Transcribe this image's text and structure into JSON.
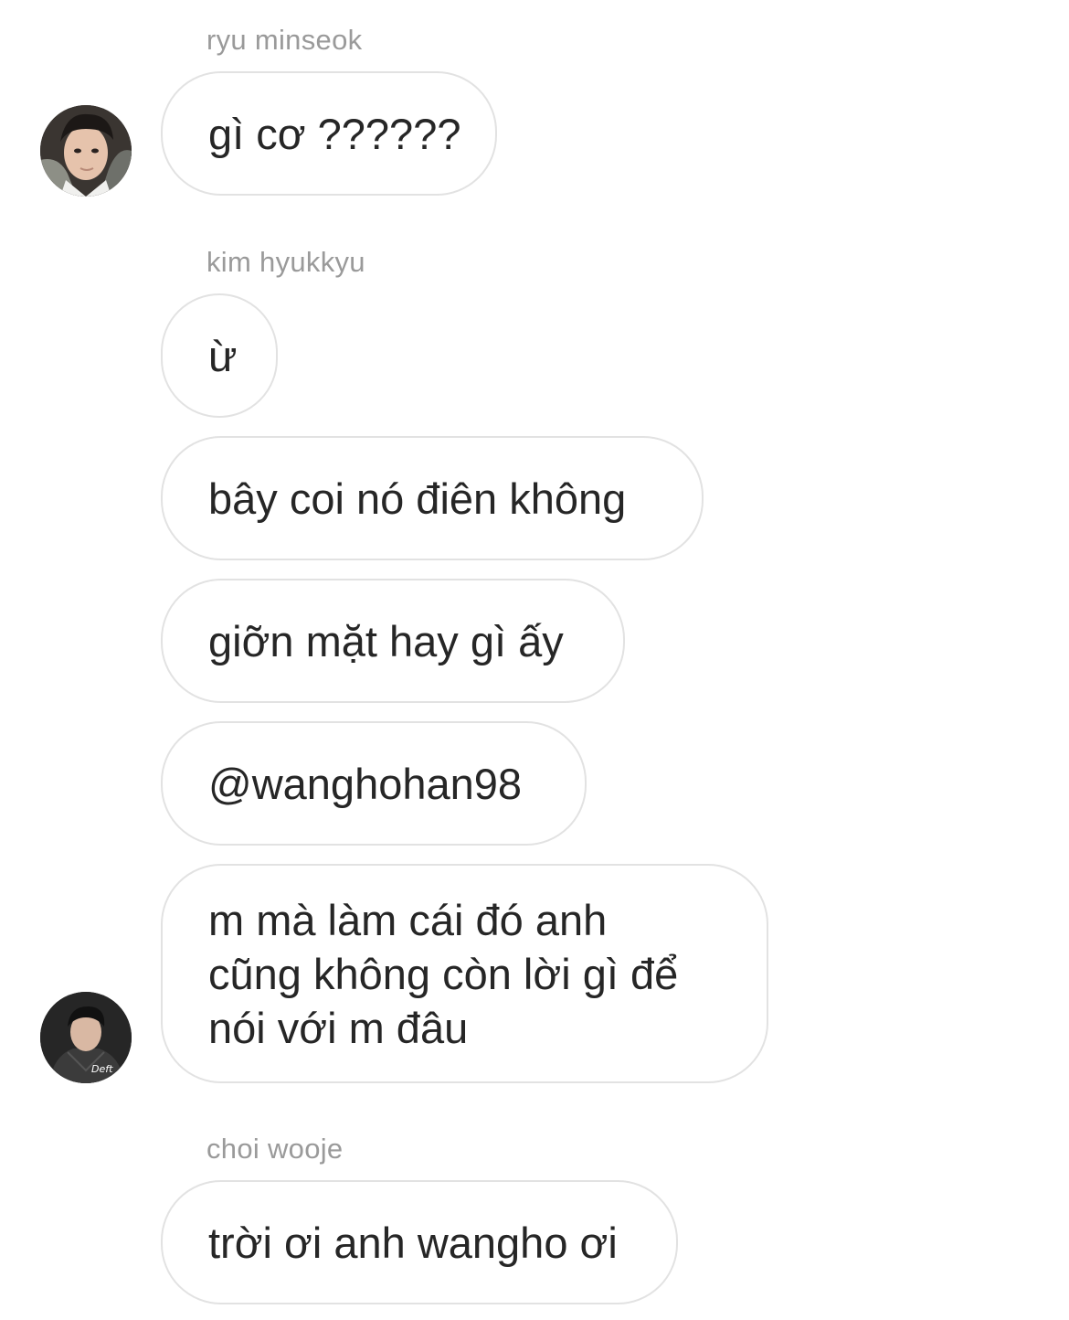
{
  "messages": [
    {
      "sender": "ryu minseok",
      "text": "gì cơ ??????"
    },
    {
      "sender": "kim hyukkyu",
      "text": "ừ"
    },
    {
      "text": "bây coi nó điên không"
    },
    {
      "text": "giỡn mặt hay gì ấy"
    },
    {
      "text": "@wanghohan98"
    },
    {
      "lines": [
        "m mà làm cái đó anh",
        "cũng không còn lời gì để",
        "nói với m đâu"
      ]
    },
    {
      "sender": "choi wooje",
      "text": "trời ơi anh wangho ơi"
    }
  ],
  "avatars": {
    "second_avatar_badge": "Deft"
  }
}
